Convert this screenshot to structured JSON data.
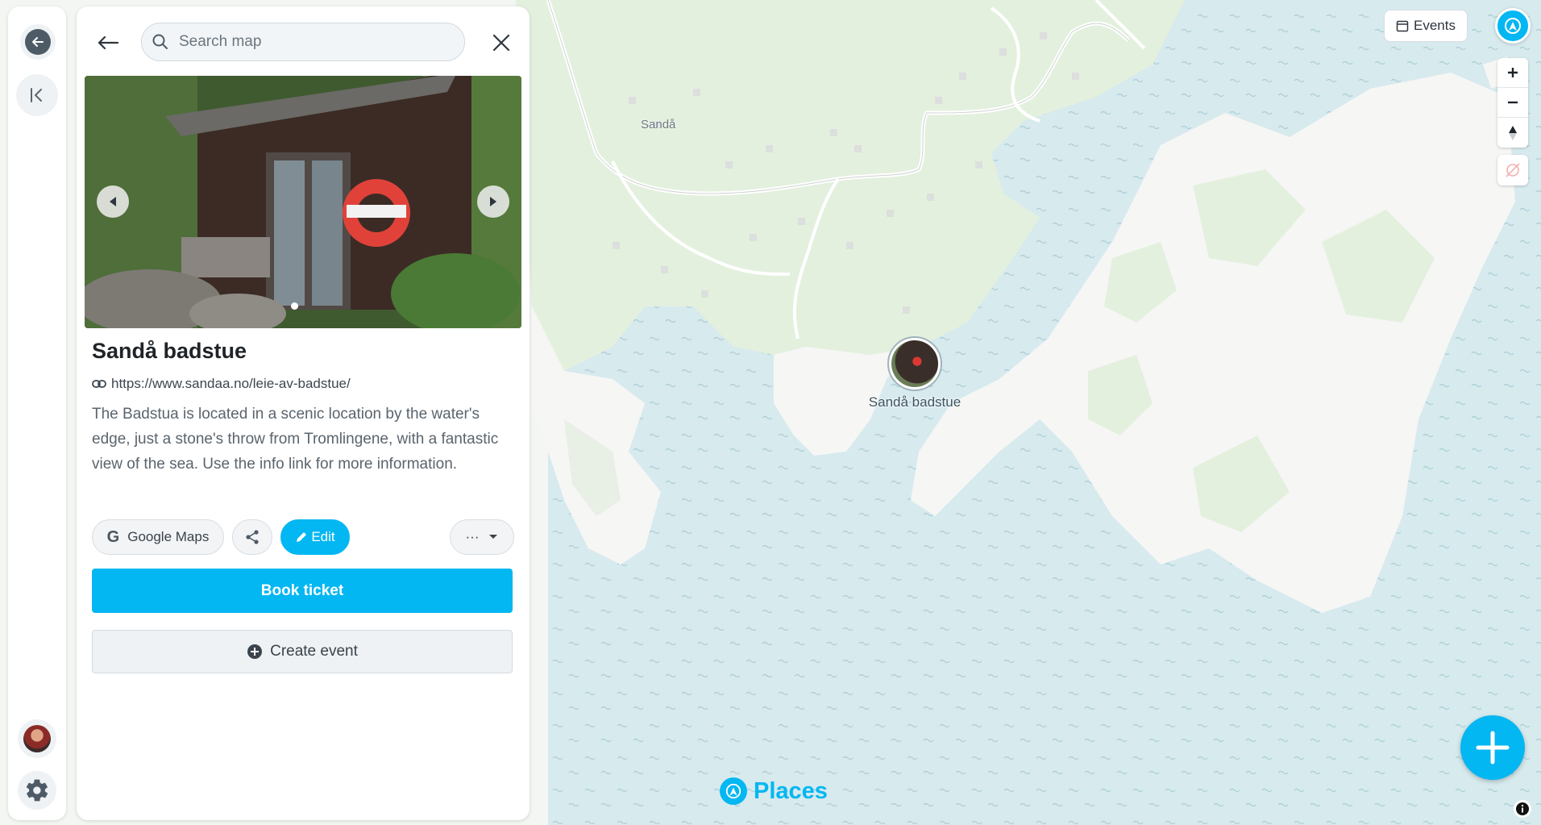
{
  "colors": {
    "accent": "#03b7f2",
    "water": "#d7eaee",
    "land": "#f6f6f5",
    "forest": "#e4f0de"
  },
  "rail": {
    "back_icon": "arrow-left-circle-icon",
    "collapse_icon": "collapse-sidebar-icon",
    "avatar_icon": "user-avatar",
    "settings_icon": "gear-icon"
  },
  "search": {
    "placeholder": "Search map",
    "back_icon": "arrow-left-icon",
    "close_icon": "close-icon"
  },
  "place": {
    "title": "Sandå badstue",
    "url": "https://www.sandaa.no/leie-av-badstue/",
    "description": "The Badstua is located in a scenic location by the water's edge, just a stone's throw from Tromlingene, with a fantastic view of the sea. Use the info link for more information.",
    "actions": {
      "google_maps": "Google Maps",
      "google_glyph": "G",
      "edit": "Edit",
      "more": "···"
    },
    "book_ticket": "Book ticket",
    "create_event": "Create event"
  },
  "map": {
    "town_label": "Sandå",
    "marker_label": "Sandå badstue",
    "events_button": "Events",
    "brand": "Places"
  }
}
